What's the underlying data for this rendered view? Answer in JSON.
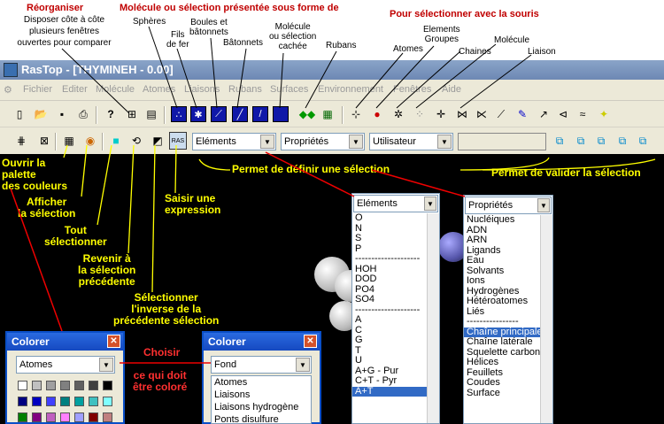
{
  "annotations_top": {
    "reorganiser": "Réorganiser",
    "reorganiser_desc1": "Disposer côte à côte",
    "reorganiser_desc2": "plusieurs fenêtres",
    "reorganiser_desc3": "ouvertes pour comparer",
    "representation_title": "Molécule ou sélection présentée sous forme de",
    "spheres": "Sphères",
    "fils": "Fils\nde fer",
    "boules": "Boules et\nbâtonnets",
    "batonnets": "Bâtonnets",
    "cachee": "Molécule\nou sélection\ncachée",
    "rubans": "Rubans",
    "souris_title": "Pour sélectionner avec la souris",
    "atomes": "Atomes",
    "elements_groupes": "Elements\nGroupes",
    "chaines": "Chaines",
    "molecule": "Molécule",
    "liaison": "Liaison"
  },
  "window": {
    "title": "RasTop - [THYMINEH - 0.00]"
  },
  "menu": [
    "Fichier",
    "Editer",
    "Molécule",
    "Atomes",
    "Liaisons",
    "Rubans",
    "Surfaces",
    "Environnement",
    "Fenêtres",
    "Aide"
  ],
  "toolbar2": {
    "elements_combo": "Eléments",
    "proprietes_combo": "Propriétés",
    "utilisateur_combo": "Utilisateur",
    "expr_button": "RAS"
  },
  "annotations_yellow": {
    "palette": "Ouvrir la\npalette\ndes couleurs",
    "afficher": "Afficher\nla sélection",
    "tout": "Tout\nsélectionner",
    "revenir": "Revenir à\nla sélection\nprécédente",
    "inverse": "Sélectionner\nl'inverse de la\nprécédente sélection",
    "saisir": "Saisir une\nexpression",
    "definir": "Permet de définir une sélection",
    "valider": "Permet de valider la sélection",
    "choisir": "Choisir",
    "colore": "ce qui doit\nêtre coloré"
  },
  "elements_list": {
    "header": "Eléments",
    "items": [
      "O",
      "N",
      "S",
      "P",
      "--------------------",
      "HOH",
      "DOD",
      "PO4",
      "SO4",
      "--------------------",
      "A",
      "C",
      "G",
      "T",
      "U",
      "A+G - Pur",
      "C+T - Pyr",
      "A+T"
    ],
    "selected": "A+T"
  },
  "proprietes_list": {
    "header": "Propriétés",
    "items": [
      "Nucléiques",
      "ADN",
      "ARN",
      "Ligands",
      "Eau",
      "Solvants",
      "Ions",
      "Hydrogènes",
      "Hétéroatomes",
      "Liés",
      "----------------",
      "Chaîne principale",
      "Chaîne latérale",
      "Squelette carbon",
      "Hélices",
      "Feuillets",
      "Coudes",
      "Surface"
    ],
    "selected": "Chaîne principale"
  },
  "colorer1": {
    "title": "Colorer",
    "combo": "Atomes"
  },
  "colorer2": {
    "title": "Colorer",
    "combo": "Fond",
    "items": [
      "Atomes",
      "Liaisons",
      "Liaisons hydrogène",
      "Ponts disulfure"
    ]
  },
  "palette_colors": [
    "#ffffff",
    "#c0c0c0",
    "#a0a0a0",
    "#808080",
    "#606060",
    "#404040",
    "#000000",
    "#000080",
    "#0000c0",
    "#4040ff",
    "#008080",
    "#00a0a0",
    "#40c0c0",
    "#80ffff",
    "#008000",
    "#800080",
    "#c060c0",
    "#ff80ff",
    "#a0a0ff",
    "#800000",
    "#c08080"
  ]
}
